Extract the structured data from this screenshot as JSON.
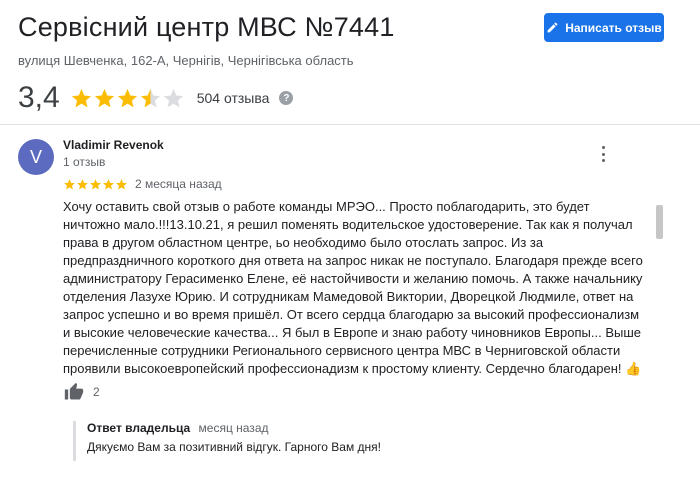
{
  "place": {
    "title": "Сервісний центр МВС №7441",
    "address": "вулиця Шевченка, 162-А, Чернігів, Чернігівська область",
    "rating_value": "3,4",
    "rating_stars": 3.5,
    "review_count": "504 отзыва",
    "write_review_label": "Написать отзыв",
    "colors": {
      "accent": "#1a73e8",
      "star": "#fbbc04",
      "star_empty": "#dadce0"
    }
  },
  "review": {
    "author_initial": "V",
    "author_name": "Vladimir Revenok",
    "author_meta": "1 отзыв",
    "stars": 5,
    "date": "2 месяца назад",
    "text": "Хочу оставить свой отзыв о работе команды МРЭО... Просто поблагодарить, это будет ничтожно мало.!!!13.10.21, я решил поменять водительское удостоверение. Так как я получал права в другом областном центре, ьо необходимо было отослать запрос. Из за предпраздничного короткого дня ответа на запрос никак не поступало. Благодаря прежде всего администратору Герасименко Елене, её настойчивости и желанию помочь. А также начальнику отделения Лазухе Юрию. И сотрудникам Мамедовой Виктории, Дворецкой Людмиле, ответ на запрос успешно и во время пришёл. От всего сердца благодарю за высокий профессионализм и высокие человеческие качества... Я был в Европе и знаю работу чиновников Европы... Выше перечисленные сотрудники Регионального сервисного центра МВС в Черниговской области проявили высокоевропейский профессионадизм к простому клиенту. Сердечно благодарен! 👍",
    "likes": "2",
    "avatar_color": "#5c6bc0",
    "owner_reply": {
      "label": "Ответ владельца",
      "date": "месяц назад",
      "text": "Дякуємо Вам за позитивний відгук. Гарного Вам дня!"
    }
  }
}
